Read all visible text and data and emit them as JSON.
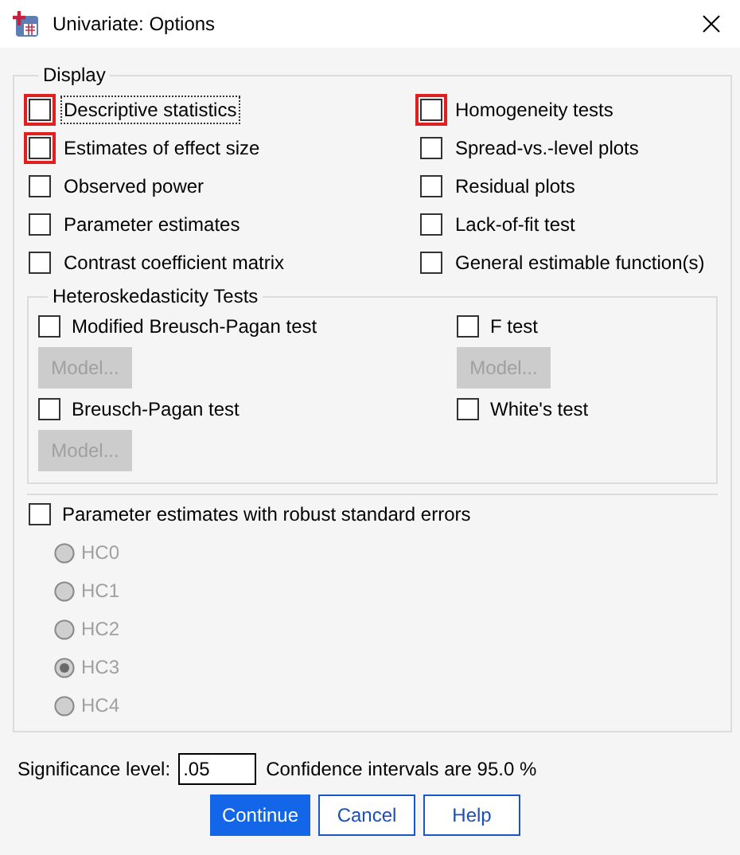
{
  "window": {
    "title": "Univariate: Options"
  },
  "display": {
    "title": "Display",
    "left_options": [
      {
        "label": "Descriptive statistics",
        "checked": false,
        "highlighted": true,
        "focused": true
      },
      {
        "label": "Estimates of effect size",
        "checked": false,
        "highlighted": true,
        "focused": false
      },
      {
        "label": "Observed power",
        "checked": false,
        "highlighted": false,
        "focused": false
      },
      {
        "label": "Parameter estimates",
        "checked": false,
        "highlighted": false,
        "focused": false
      },
      {
        "label": "Contrast coefficient matrix",
        "checked": false,
        "highlighted": false,
        "focused": false
      }
    ],
    "right_options": [
      {
        "label": "Homogeneity tests",
        "checked": false,
        "highlighted": true,
        "focused": false
      },
      {
        "label": "Spread-vs.-level plots",
        "checked": false,
        "highlighted": false,
        "focused": false
      },
      {
        "label": "Residual plots",
        "checked": false,
        "highlighted": false,
        "focused": false
      },
      {
        "label": "Lack-of-fit test",
        "checked": false,
        "highlighted": false,
        "focused": false
      },
      {
        "label": "General estimable function(s)",
        "checked": false,
        "highlighted": false,
        "focused": false
      }
    ]
  },
  "heteroskedasticity": {
    "title": "Heteroskedasticity Tests",
    "tests": [
      {
        "label": "Modified Breusch-Pagan test",
        "checked": false,
        "model_button": {
          "label": "Model...",
          "disabled": true
        }
      },
      {
        "label": "F test",
        "checked": false,
        "model_button": {
          "label": "Model...",
          "disabled": true
        }
      },
      {
        "label": "Breusch-Pagan test",
        "checked": false,
        "model_button": {
          "label": "Model...",
          "disabled": true
        }
      },
      {
        "label": "White's test",
        "checked": false
      }
    ]
  },
  "robust": {
    "label": "Parameter estimates with robust standard errors",
    "checked": false,
    "options": [
      {
        "label": "HC0",
        "selected": false,
        "disabled": true
      },
      {
        "label": "HC1",
        "selected": false,
        "disabled": true
      },
      {
        "label": "HC2",
        "selected": false,
        "disabled": true
      },
      {
        "label": "HC3",
        "selected": true,
        "disabled": true
      },
      {
        "label": "HC4",
        "selected": false,
        "disabled": true
      }
    ]
  },
  "significance": {
    "label": "Significance level:",
    "value": ".05",
    "note": "Confidence intervals are 95.0 %"
  },
  "buttons": [
    {
      "label": "Continue",
      "kind": "primary"
    },
    {
      "label": "Cancel",
      "kind": "normal"
    },
    {
      "label": "Help",
      "kind": "normal"
    }
  ]
}
